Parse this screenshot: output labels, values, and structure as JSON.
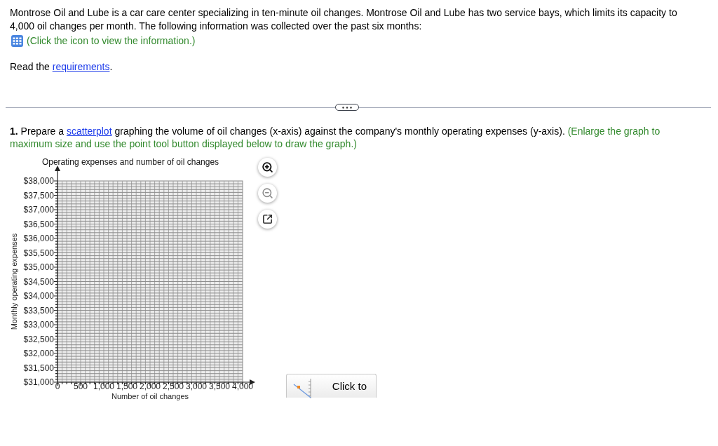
{
  "intro": {
    "text": "Montrose Oil and Lube is a car care center specializing in ten-minute oil changes. Montrose Oil and Lube has two service bays, which limits its capacity to 4,000 oil changes per month. The following information was collected over the past six months:"
  },
  "info_line": {
    "text": "(Click the icon to view the information.)"
  },
  "requirements_line": {
    "before": "Read the ",
    "link": "requirements",
    "after": "."
  },
  "question": {
    "number": "1.",
    "before": "Prepare a ",
    "link": "scatterplot",
    "after": " graphing the volume of oil changes (x-axis) against the company's monthly operating expenses (y-axis).",
    "instruction": "(Enlarge the graph to maximum size and use the point tool button displayed below to draw the graph.)"
  },
  "graph": {
    "chart_data": {
      "type": "scatter",
      "title": "Operating expenses and number of oil changes",
      "xlabel": "Number of oil changes",
      "ylabel": "Monthly operating expenses",
      "xlim": [
        0,
        4000
      ],
      "ylim": [
        31000,
        38000
      ],
      "grid": true,
      "xticks": [
        {
          "value": 0,
          "label": "0"
        },
        {
          "value": 500,
          "label": "500"
        },
        {
          "value": 1000,
          "label": "1,000"
        },
        {
          "value": 1500,
          "label": "1,500"
        },
        {
          "value": 2000,
          "label": "2,000"
        },
        {
          "value": 2500,
          "label": "2,500"
        },
        {
          "value": 3000,
          "label": "3,000"
        },
        {
          "value": 3500,
          "label": "3,500"
        },
        {
          "value": 4000,
          "label": "4,000"
        }
      ],
      "yticks": [
        {
          "value": 31000,
          "label": "$31,000"
        },
        {
          "value": 31500,
          "label": "$31,500"
        },
        {
          "value": 32000,
          "label": "$32,000"
        },
        {
          "value": 32500,
          "label": "$32,500"
        },
        {
          "value": 33000,
          "label": "$33,000"
        },
        {
          "value": 33500,
          "label": "$33,500"
        },
        {
          "value": 34000,
          "label": "$34,000"
        },
        {
          "value": 34500,
          "label": "$34,500"
        },
        {
          "value": 35000,
          "label": "$35,000"
        },
        {
          "value": 35500,
          "label": "$35,500"
        },
        {
          "value": 36000,
          "label": "$36,000"
        },
        {
          "value": 36500,
          "label": "$36,500"
        },
        {
          "value": 37000,
          "label": "$37,000"
        },
        {
          "value": 37500,
          "label": "$37,500"
        },
        {
          "value": 38000,
          "label": "$38,000"
        }
      ]
    },
    "tools": [
      {
        "kind": "zoom_in",
        "disabled": false
      },
      {
        "kind": "zoom_out",
        "disabled": true
      },
      {
        "kind": "pop_out",
        "disabled": false
      }
    ],
    "enlarge_button": {
      "label": "Click to"
    }
  }
}
